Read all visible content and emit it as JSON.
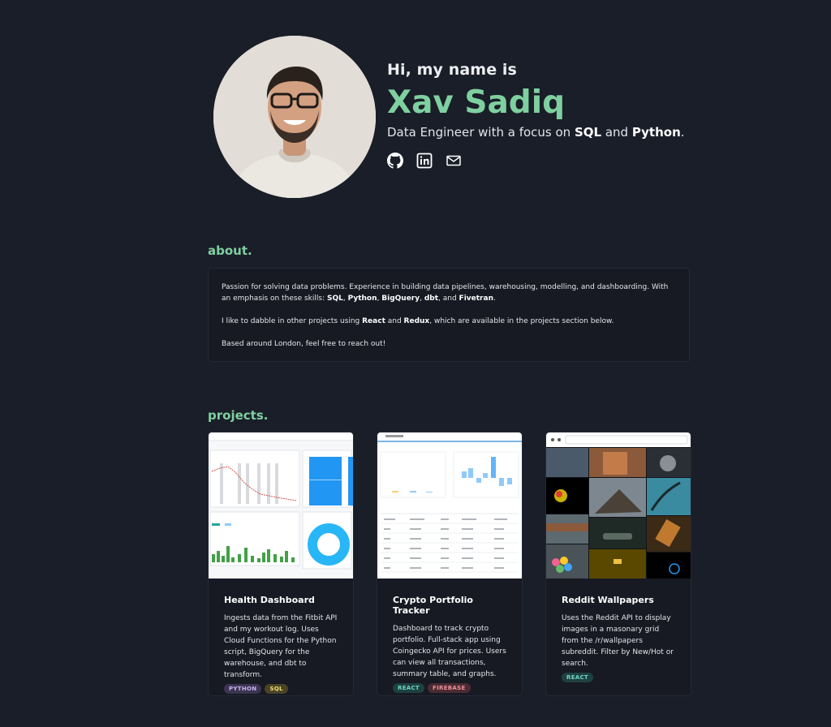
{
  "hero": {
    "greeting": "Hi, my name is",
    "name": "Xav Sadiq",
    "tagline_prefix": "Data Engineer with a focus on ",
    "skill_1": "SQL",
    "tagline_mid": " and ",
    "skill_2": "Python",
    "tagline_suffix": ".",
    "socials": [
      "github-icon",
      "linkedin-icon",
      "mail-icon"
    ]
  },
  "about": {
    "title": "about.",
    "p1_a": "Passion for solving data problems. Experience in building data pipelines, warehousing, modelling, and dashboarding. With an emphasis on these skills: ",
    "p1_skills": [
      "SQL",
      "Python",
      "BigQuery",
      "dbt",
      "Fivetran"
    ],
    "p1_sep": ", ",
    "p1_and": ", and ",
    "p1_end": ".",
    "p2_a": "I like to dabble in other projects using ",
    "p2_b1": "React",
    "p2_mid": " and ",
    "p2_b2": "Redux",
    "p2_end": ", which are available in the projects section below.",
    "p3": "Based around London, feel free to reach out!"
  },
  "projects": {
    "title": "projects.",
    "items": [
      {
        "title": "Health Dashboard",
        "description": "Ingests data from the Fitbit API and my workout log. Uses Cloud Functions for the Python script, BigQuery for the warehouse, and dbt to transform.",
        "tags": [
          {
            "label": "PYTHON",
            "bg": "#3b3552",
            "fg": "#c7b3f0"
          },
          {
            "label": "SQL",
            "bg": "#4a4426",
            "fg": "#f0de72"
          }
        ]
      },
      {
        "title": "Crypto Portfolio Tracker",
        "description": "Dashboard to track crypto portfolio. Full-stack app using Coingecko API for prices. Users can view all transactions, summary table, and graphs.",
        "tags": [
          {
            "label": "REACT",
            "bg": "#1f4040",
            "fg": "#6fd6c8"
          },
          {
            "label": "FIREBASE",
            "bg": "#4a2b32",
            "fg": "#f0909c"
          }
        ]
      },
      {
        "title": "Reddit Wallpapers",
        "description": "Uses the Reddit API to display images in a masonary grid from the /r/wallpapers subreddit. Filter by New/Hot or search.",
        "tags": [
          {
            "label": "REACT",
            "bg": "#1f4040",
            "fg": "#6fd6c8"
          }
        ]
      }
    ]
  },
  "colors": {
    "background": "#1a1e28",
    "accent": "#7fd0a0",
    "card": "#171a23"
  }
}
